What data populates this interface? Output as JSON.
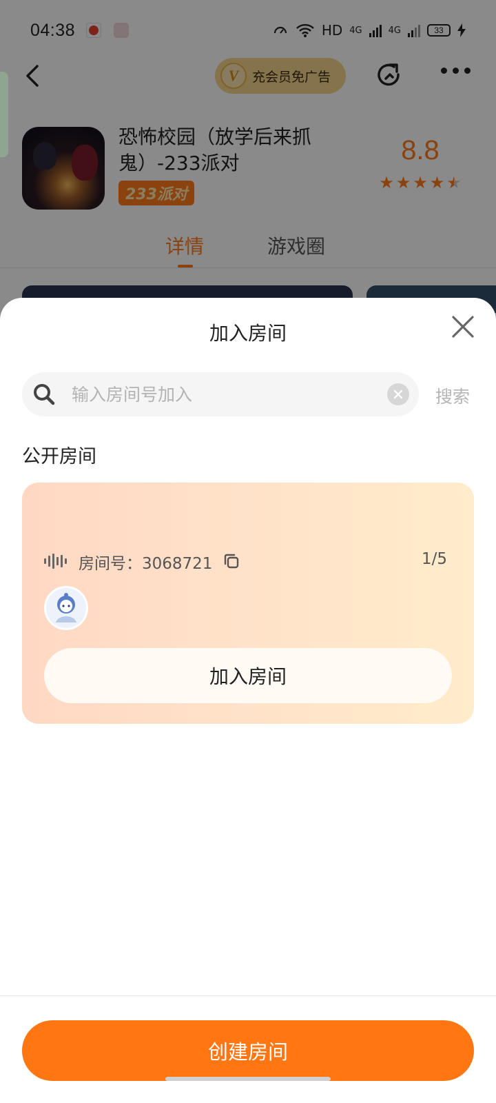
{
  "status_bar": {
    "time": "04:38",
    "network": "HD",
    "signal_1": "4G",
    "signal_2": "4G",
    "battery": "33"
  },
  "top_bar": {
    "vip_badge": "V",
    "vip_label": "充会员免广告"
  },
  "app": {
    "title": "恐怖校园（放学后来抓鬼）-233派对",
    "tag": "233派对",
    "rating": "8.8",
    "stars": 4.5
  },
  "tabs": [
    {
      "label": "详情",
      "active": true
    },
    {
      "label": "游戏圈",
      "active": false
    }
  ],
  "sheet": {
    "title": "加入房间",
    "search": {
      "placeholder": "输入房间号加入",
      "value": "",
      "action_label": "搜索"
    },
    "section_label": "公开房间",
    "rooms": [
      {
        "room_number_label": "房间号：3068721",
        "count": "1/5",
        "join_label": "加入房间"
      }
    ],
    "create_label": "创建房间"
  },
  "colors": {
    "accent": "#ff7613",
    "card_gradient_start": "#ffd8c4",
    "card_gradient_end": "#ffeccb",
    "vip_pill": "#f6d58d"
  }
}
